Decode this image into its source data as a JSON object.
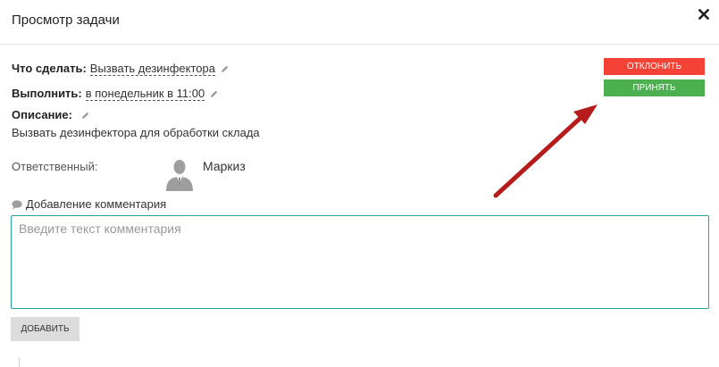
{
  "modal": {
    "title": "Просмотр задачи"
  },
  "task": {
    "what_label": "Что сделать:",
    "what_value": "Вызвать дезинфектора",
    "due_label": "Выполнить:",
    "due_value": "в понедельник в 11:00",
    "description_label": "Описание:",
    "description_text": "Вызвать дезинфектора для обработки склада"
  },
  "responsible": {
    "label": "Ответственный:",
    "name": "Маркиз"
  },
  "comment": {
    "heading": "Добавление комментария",
    "placeholder": "Введите текст комментария",
    "value": "",
    "add_label": "Добавить"
  },
  "actions": {
    "reject_label": "Отклонить",
    "accept_label": "Принять"
  },
  "icons": {
    "close": "close-icon",
    "edit": "pencil-icon",
    "comment": "speech-bubble-icon",
    "avatar": "user-silhouette-icon",
    "annotation": "red-arrow"
  },
  "colors": {
    "reject": "#f44336",
    "accept": "#4caf50",
    "annotation_arrow": "#b71c1c",
    "comment_border": "#2aa198"
  }
}
